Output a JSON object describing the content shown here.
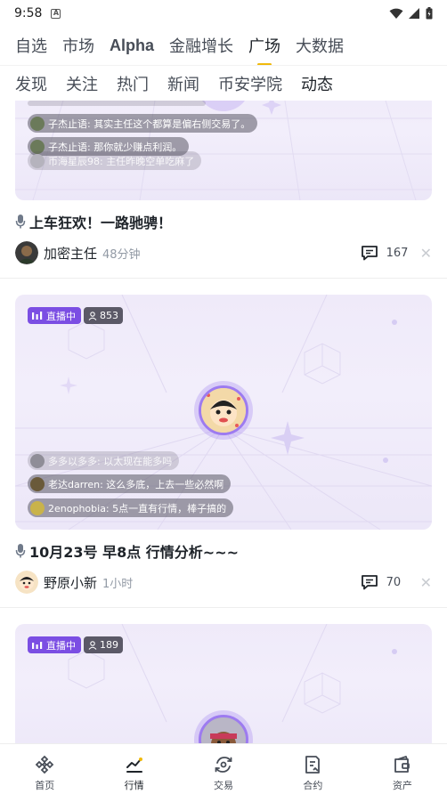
{
  "status": {
    "time": "9:58",
    "notif": "A"
  },
  "main_tabs": [
    {
      "label": "自选"
    },
    {
      "label": "市场"
    },
    {
      "label": "Alpha"
    },
    {
      "label": "金融增长"
    },
    {
      "label": "广场"
    },
    {
      "label": "大数据"
    }
  ],
  "sub_tabs": [
    {
      "label": "发现"
    },
    {
      "label": "关注"
    },
    {
      "label": "热门"
    },
    {
      "label": "新闻"
    },
    {
      "label": "币安学院"
    },
    {
      "label": "动态"
    }
  ],
  "posts": [
    {
      "chats": [
        "子杰止语: 其实主任这个都算是偏右侧交易了。",
        "子杰止语: 那你就少赚点利润。",
        "币海星辰98: 主任昨晚空单吃麻了"
      ],
      "title": "上车狂欢！一路驰骋！",
      "author": "加密主任",
      "time": "48分钟",
      "comments": "167"
    },
    {
      "live_label": "直播中",
      "viewers": "853",
      "chats": [
        "多多以多多: 以太现在能多吗",
        "老达darren: 这么多底，上去一些必然啊",
        "2enophobia: 5点一直有行情，棒子搞的"
      ],
      "title": "10月23号 早8点 行情分析~~~",
      "author": "野原小新",
      "time": "1小时",
      "comments": "70"
    },
    {
      "live_label": "直播中",
      "viewers": "189"
    }
  ],
  "bottom_nav": [
    {
      "label": "首页",
      "icon": "binance-logo-icon"
    },
    {
      "label": "行情",
      "icon": "chart-trend-icon"
    },
    {
      "label": "交易",
      "icon": "trade-swap-icon"
    },
    {
      "label": "合约",
      "icon": "contract-doc-icon"
    },
    {
      "label": "资产",
      "icon": "wallet-icon"
    }
  ],
  "colors": {
    "accent": "#f0b90b",
    "live": "#7b4ee3",
    "card_bg": "#efeaf9"
  }
}
